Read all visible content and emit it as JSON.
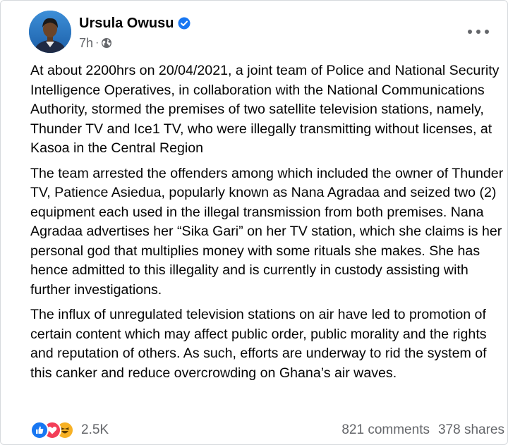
{
  "post": {
    "author": "Ursula Owusu",
    "time": "7h",
    "time_separator": "·",
    "paragraphs": [
      "At about 2200hrs on 20/04/2021, a joint team of Police and National Security Intelligence Operatives, in collaboration with the National Communications Authority, stormed the premises of two satellite television stations, namely, Thunder TV and Ice1 TV, who were illegally transmitting without licenses, at Kasoa in the Central Region",
      "The team arrested the offenders among which included the owner of Thunder TV, Patience Asiedua, popularly known as Nana Agradaa and seized two (2) equipment each used in the illegal transmission from both premises. Nana Agradaa advertises her “Sika Gari” on her TV station, which she claims is her personal god that multiplies money with some rituals she makes. She has hence admitted to this illegality and is currently in custody assisting with further investigations.",
      "The influx of unregulated television stations on air have led to promotion of certain content which may affect public order, public morality and the rights and reputation of others. As such, efforts are underway to rid the system of this canker and reduce overcrowding on Ghana’s air waves."
    ],
    "reactions": {
      "icons": [
        "like-icon",
        "love-icon",
        "haha-icon"
      ],
      "count": "2.5K"
    },
    "comments": "821 comments",
    "shares": "378 shares"
  },
  "colors": {
    "verified": "#1877f2",
    "like": "#1877f2",
    "love": "#f33e58",
    "haha": "#f7b125",
    "secondary_text": "#65676b"
  }
}
